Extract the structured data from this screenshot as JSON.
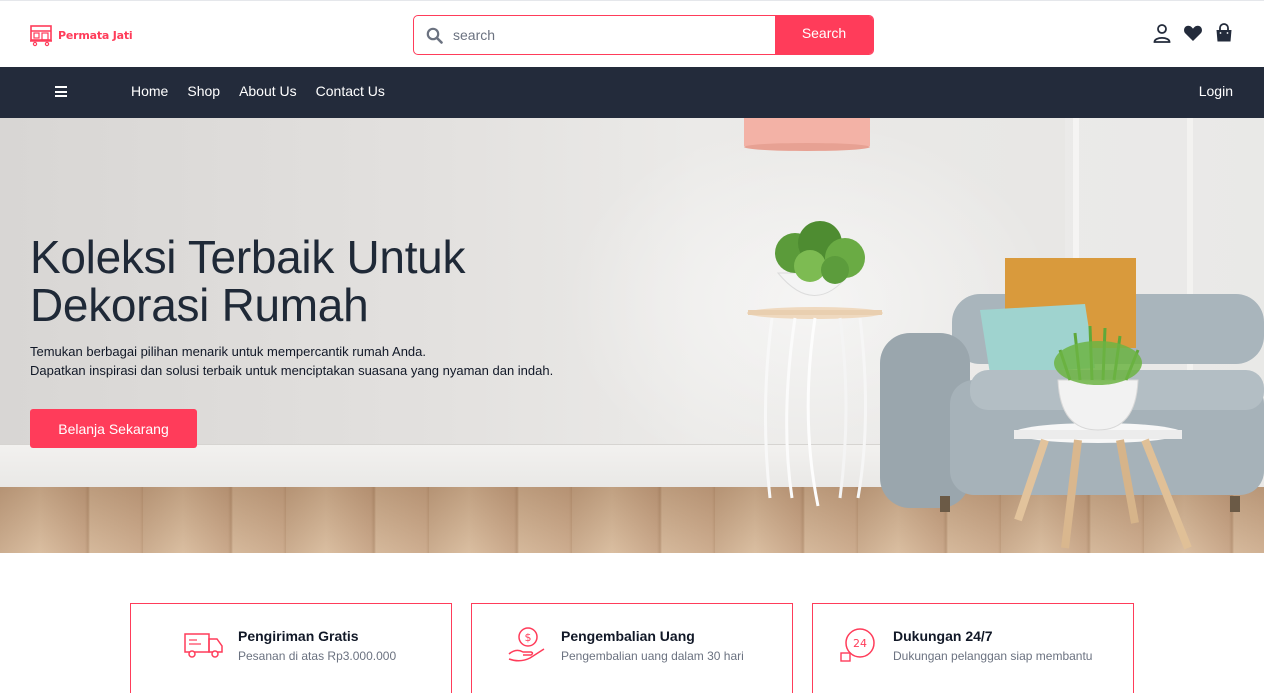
{
  "brand": {
    "name": "Permata Jati",
    "color": "#ff3c5a"
  },
  "search": {
    "placeholder": "search",
    "value": "",
    "button_label": "Search"
  },
  "header_icons": [
    "user-icon",
    "heart-icon",
    "shopping-bag-icon"
  ],
  "nav": {
    "menu_icon": "hamburger-icon",
    "links": [
      "Home",
      "Shop",
      "About Us",
      "Contact Us"
    ],
    "login_label": "Login",
    "background": "#232b3b"
  },
  "hero": {
    "title_lines": [
      "Koleksi Terbaik Untuk",
      "Dekorasi Rumah"
    ],
    "description_lines": [
      "Temukan berbagai pilihan menarik untuk mempercantik rumah Anda.",
      "Dapatkan inspirasi dan solusi terbaik untuk menciptakan suasana yang nyaman dan indah."
    ],
    "cta_label": "Belanja Sekarang"
  },
  "features": [
    {
      "icon": "delivery-truck-icon",
      "title": "Pengiriman Gratis",
      "subtitle": "Pesanan di atas Rp3.000.000"
    },
    {
      "icon": "money-back-icon",
      "title": "Pengembalian Uang",
      "subtitle": "Pengembalian uang dalam 30 hari"
    },
    {
      "icon": "support-24-icon",
      "title": "Dukungan 24/7",
      "subtitle": "Dukungan pelanggan siap membantu"
    }
  ]
}
